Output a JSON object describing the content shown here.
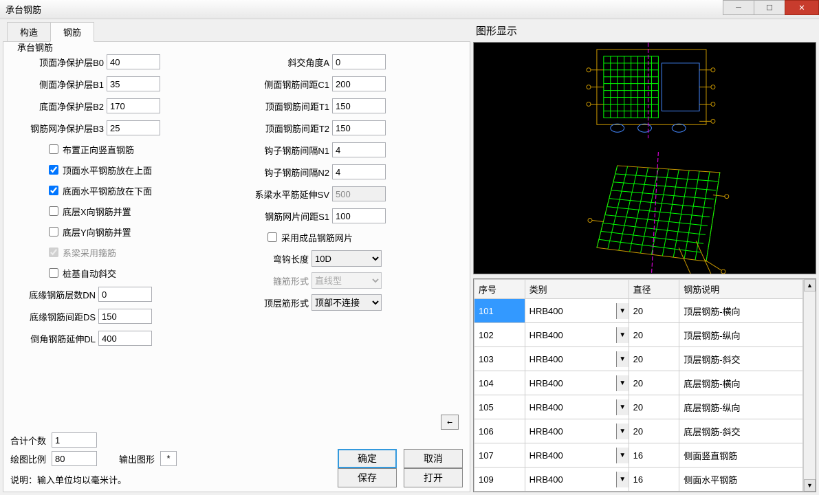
{
  "window": {
    "title": "承台钢筋"
  },
  "tabs": [
    "构造",
    "钢筋"
  ],
  "active_tab": "钢筋",
  "fieldset_legend": "承台钢筋",
  "left": {
    "B0": {
      "label": "顶面净保护层B0",
      "value": "40"
    },
    "B1": {
      "label": "侧面净保护层B1",
      "value": "35"
    },
    "B2": {
      "label": "底面净保护层B2",
      "value": "170"
    },
    "B3": {
      "label": "钢筋网净保护层B3",
      "value": "25"
    },
    "chk1": "布置正向竖直钢筋",
    "chk2": "顶面水平钢筋放在上面",
    "chk3": "底面水平钢筋放在下面",
    "chk4": "底层X向钢筋并置",
    "chk5": "底层Y向钢筋并置",
    "chk6": "系梁采用箍筋",
    "chk7": "桩基自动斜交",
    "DN": {
      "label": "底缘钢筋层数DN",
      "value": "0"
    },
    "DS": {
      "label": "底缘钢筋间距DS",
      "value": "150"
    },
    "DL": {
      "label": "倒角钢筋延伸DL",
      "value": "400"
    }
  },
  "right": {
    "A": {
      "label": "斜交角度A",
      "value": "0"
    },
    "C1": {
      "label": "侧面钢筋间距C1",
      "value": "200"
    },
    "T1": {
      "label": "顶面钢筋间距T1",
      "value": "150"
    },
    "T2": {
      "label": "顶面钢筋间距T2",
      "value": "150"
    },
    "N1": {
      "label": "钩子钢筋间隔N1",
      "value": "4"
    },
    "N2": {
      "label": "钩子钢筋间隔N2",
      "value": "4"
    },
    "SV": {
      "label": "系梁水平筋延伸SV",
      "value": "500"
    },
    "S1": {
      "label": "钢筋网片间距S1",
      "value": "100"
    },
    "chk8": "采用成品钢筋网片",
    "hook": {
      "label": "弯钩长度",
      "value": "10D"
    },
    "stirrup": {
      "label": "箍筋形式",
      "value": "直线型"
    },
    "toprebar": {
      "label": "顶层筋形式",
      "value": "顶部不连接"
    }
  },
  "bottom": {
    "count": {
      "label": "合计个数",
      "value": "1"
    },
    "scale": {
      "label": "绘图比例",
      "value": "80"
    },
    "output": {
      "label": "输出图形",
      "value": "*"
    },
    "note": "说明：输入单位均以毫米计。",
    "ok": "确定",
    "cancel": "取消",
    "save": "保存",
    "open": "打开",
    "arrow": "←"
  },
  "viewer_label": "图形显示",
  "table": {
    "headers": [
      "序号",
      "类别",
      "直径",
      "钢筋说明"
    ],
    "rows": [
      {
        "no": "101",
        "type": "HRB400",
        "dia": "20",
        "desc": "顶层钢筋-横向",
        "sel": true
      },
      {
        "no": "102",
        "type": "HRB400",
        "dia": "20",
        "desc": "顶层钢筋-纵向"
      },
      {
        "no": "103",
        "type": "HRB400",
        "dia": "20",
        "desc": "顶层钢筋-斜交"
      },
      {
        "no": "104",
        "type": "HRB400",
        "dia": "20",
        "desc": "底层钢筋-横向"
      },
      {
        "no": "105",
        "type": "HRB400",
        "dia": "20",
        "desc": "底层钢筋-纵向"
      },
      {
        "no": "106",
        "type": "HRB400",
        "dia": "20",
        "desc": "底层钢筋-斜交"
      },
      {
        "no": "107",
        "type": "HRB400",
        "dia": "16",
        "desc": "侧面竖直钢筋"
      },
      {
        "no": "109",
        "type": "HRB400",
        "dia": "16",
        "desc": "侧面水平钢筋"
      }
    ]
  }
}
